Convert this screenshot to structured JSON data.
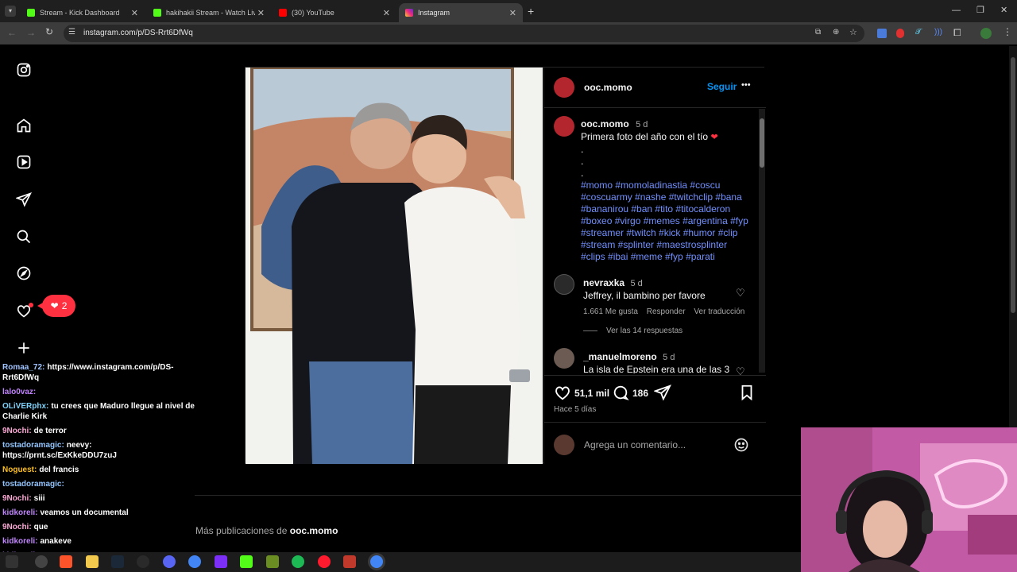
{
  "browser": {
    "tabs": [
      {
        "title": "Stream - Kick Dashboard",
        "icon": "kick-icon",
        "color": "#53fc18"
      },
      {
        "title": "hakihakii Stream - Watch Live o",
        "icon": "kick-icon",
        "color": "#53fc18"
      },
      {
        "title": "(30) YouTube",
        "icon": "youtube-icon",
        "color": "#ff0000"
      },
      {
        "title": "Instagram",
        "icon": "instagram-icon",
        "color": "#e1306c"
      }
    ],
    "new_tab": "+",
    "url": "instagram.com/p/DS-Rrt6DfWq"
  },
  "sidebar": {
    "items": [
      "instagram-logo-icon",
      "home-icon",
      "reels-icon",
      "direct-icon",
      "search-icon",
      "explore-icon",
      "notifications-icon",
      "create-icon"
    ],
    "notification_count": "2"
  },
  "post": {
    "author": "ooc.momo",
    "follow_label": "Seguir",
    "more_label": "•••",
    "caption": {
      "author": "ooc.momo",
      "age": "5 d",
      "text": "Primera foto del año con el tío",
      "dots": [
        ".",
        ".",
        "."
      ],
      "hashtags": "#momo #momoladinastia #coscu #coscuarmy #nashe #twitchclip #bana #bananirou #ban #tito #titocalderon #boxeo #virgo #memes #argentina #fyp #streamer #twitch #kick #humor #clip #stream #splinter #maestrosplinter #clips #ibai #meme #fyp #parati"
    },
    "comments": [
      {
        "user": "nevraxka",
        "age": "5 d",
        "text": "Jeffrey, il bambino per favore",
        "likes": "1.661 Me gusta",
        "reply": "Responder",
        "translate": "Ver traducción",
        "view_replies": "Ver las 14 respuestas"
      },
      {
        "user": "_manuelmoreno",
        "age": "5 d",
        "text": "La isla de Epstein era una de las 3"
      }
    ],
    "likes": "51,1 mil",
    "comment_count": "186",
    "posted": "Hace 5 días",
    "comment_placeholder": "Agrega un comentario..."
  },
  "more_posts": {
    "prefix": "Más publicaciones de ",
    "author": "ooc.momo"
  },
  "chat": [
    {
      "user": "Romaa_72:",
      "color": "#a0c4ff",
      "text": "https://www.instagram.com/p/DS-Rrt6DfWq"
    },
    {
      "user": "lalo0vaz:",
      "color": "#c084fc",
      "text": ""
    },
    {
      "user": "OLiVERphx:",
      "color": "#7dd3fc",
      "text": "tu crees que Maduro llegue al nivel de Charlie Kirk"
    },
    {
      "user": "9Nochi:",
      "color": "#f9a8d4",
      "text": "de terror"
    },
    {
      "user": "tostadoramagic:",
      "color": "#93c5fd",
      "text": "neevy: https://prnt.sc/ExKkeDDU7zuJ"
    },
    {
      "user": "Noguest:",
      "color": "#fbbf24",
      "text": "del francis"
    },
    {
      "user": "tostadoramagic:",
      "color": "#93c5fd",
      "text": ""
    },
    {
      "user": "9Nochi:",
      "color": "#f9a8d4",
      "text": "siii"
    },
    {
      "user": "kidkoreli:",
      "color": "#c084fc",
      "text": "veamos un documental"
    },
    {
      "user": "9Nochi:",
      "color": "#f9a8d4",
      "text": "que"
    },
    {
      "user": "kidkoreli:",
      "color": "#c084fc",
      "text": "anakeve"
    },
    {
      "user": "kidkoreli:",
      "color": "#c084fc",
      "text": ""
    }
  ],
  "colors": {
    "accent_blue": "#0095f6",
    "hashtag": "#7290ff",
    "like_red": "#ff3040"
  }
}
